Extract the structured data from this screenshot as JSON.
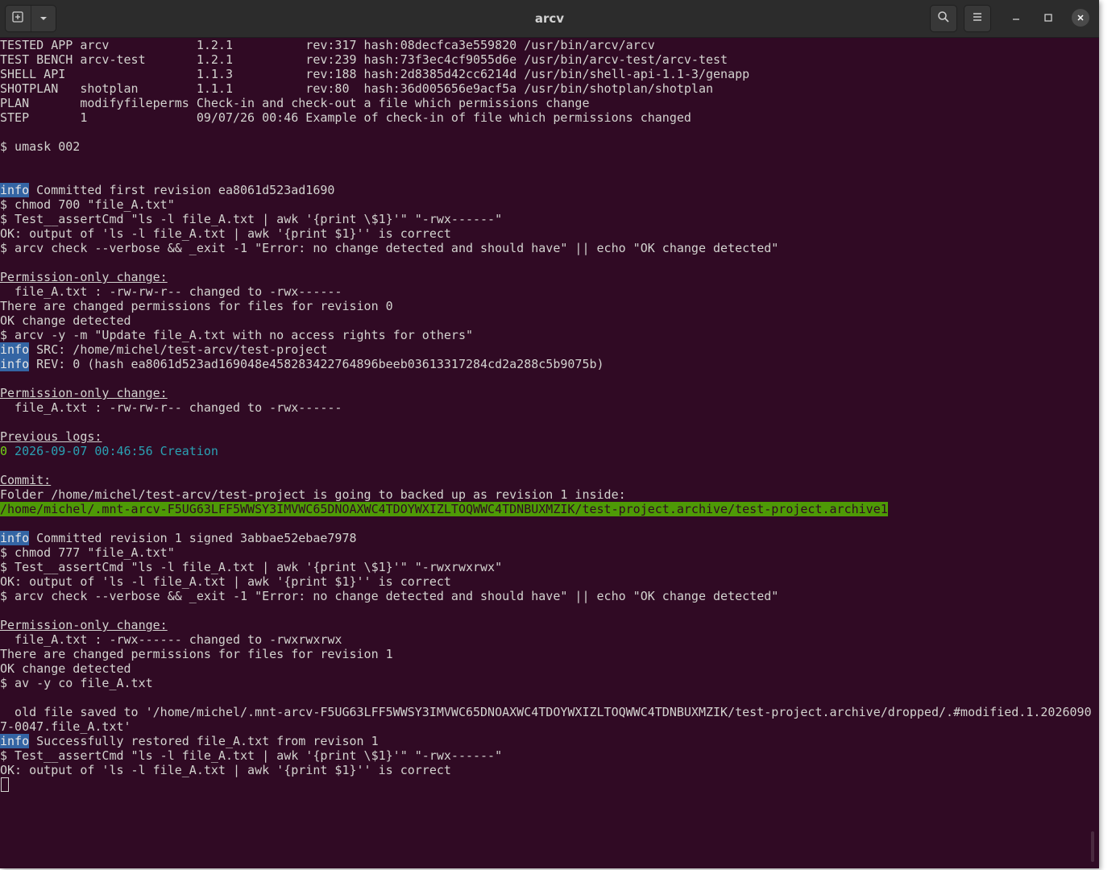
{
  "window": {
    "title": "arcv"
  },
  "icons": {
    "new_tab": "new-tab-icon",
    "menu_dropdown": "chevron-down-icon",
    "search": "search-icon",
    "hamburger": "hamburger-menu-icon",
    "minimize": "minimize-icon",
    "maximize": "maximize-icon",
    "close": "close-icon"
  },
  "colors": {
    "terminal_bg": "#300a24",
    "info_badge_bg": "#3465a4",
    "path_highlight_bg": "#4e9a06",
    "revision_number": "#73d216",
    "timestamp": "#2aa1b3"
  },
  "terminal": {
    "lines": [
      "TESTED APP arcv            1.2.1          rev:317 hash:08decfca3e559820 /usr/bin/arcv/arcv",
      "TEST BENCH arcv-test       1.2.1          rev:239 hash:73f3ec4cf9055d6e /usr/bin/arcv-test/arcv-test",
      "SHELL API                  1.1.3          rev:188 hash:2d8385d42cc6214d /usr/bin/shell-api-1.1-3/genapp",
      "SHOTPLAN   shotplan        1.1.1          rev:80  hash:36d005656e9acf5a /usr/bin/shotplan/shotplan",
      "PLAN       modifyfileperms Check-in and check-out a file which permissions change",
      "STEP       1               09/07/26 00:46 Example of check-in of file which permissions changed",
      "",
      "$ umask 002",
      "",
      "",
      "info| Committed first revision ea8061d523ad1690",
      "$ chmod 700 \"file_A.txt\"",
      "$ Test__assertCmd \"ls -l file_A.txt | awk '{print \\$1}'\" \"-rwx------\"",
      "OK: output of 'ls -l file_A.txt | awk '{print $1}'' is correct",
      "$ arcv check --verbose && _exit -1 \"Error: no change detected and should have\" || echo \"OK change detected\"",
      "",
      "Permission-only change:",
      "  file_A.txt : -rw-rw-r-- changed to -rwx------",
      "There are changed permissions for files for revision 0",
      "OK change detected",
      "$ arcv -y -m \"Update file_A.txt with no access rights for others\"",
      "info| SRC: /home/michel/test-arcv/test-project",
      "info| REV: 0 (hash ea8061d523ad169048e458283422764896beeb03613317284cd2a288c5b9075b)",
      "",
      "Permission-only change:",
      "  file_A.txt : -rw-rw-r-- changed to -rwx------",
      "",
      "Previous logs:",
      "0| 2026-09-07 00:46:56 Creation",
      "",
      "Commit:",
      "Folder /home/michel/test-arcv/test-project is going to backed up as revision 1 inside:",
      "/home/michel/.mnt-arcv-F5UG63LFF5WWSY3IMVWC65DNOAXWC4TDOYWXIZLTOQWWC4TDNBUXMZIK/test-project.archive/test-project.archive1",
      "",
      "info| Committed revision 1 signed 3abbae52ebae7978",
      "$ chmod 777 \"file_A.txt\"",
      "$ Test__assertCmd \"ls -l file_A.txt | awk '{print \\$1}'\" \"-rwxrwxrwx\"",
      "OK: output of 'ls -l file_A.txt | awk '{print $1}'' is correct",
      "$ arcv check --verbose && _exit -1 \"Error: no change detected and should have\" || echo \"OK change detected\"",
      "",
      "Permission-only change:",
      "  file_A.txt : -rwx------ changed to -rwxrwxrwx",
      "There are changed permissions for files for revision 1",
      "OK change detected",
      "$ av -y co file_A.txt",
      "",
      "  old file saved to '/home/michel/.mnt-arcv-F5UG63LFF5WWSY3IMVWC65DNOAXWC4TDOYWXIZLTOQWWC4TDNBUXMZIK/test-project.archive/dropped/.#modified.1.2026090",
      "7-0047.file_A.txt'",
      "info| Successfully restored file_A.txt from revison 1",
      "$ Test__assertCmd \"ls -l file_A.txt | awk '{print \\$1}'\" \"-rwx------\"",
      "OK: output of 'ls -l file_A.txt | awk '{print $1}'' is correct"
    ]
  }
}
